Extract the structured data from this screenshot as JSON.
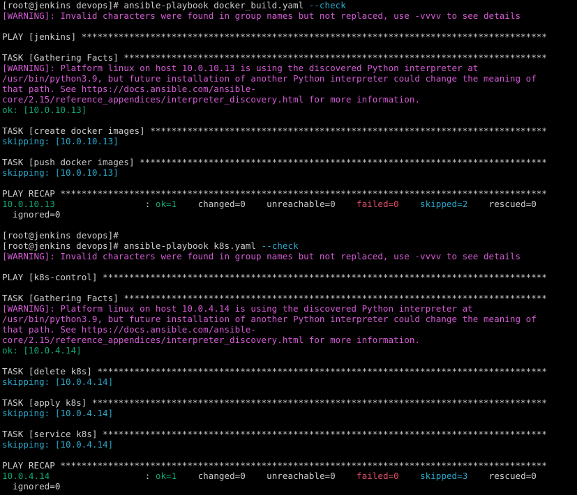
{
  "colors": {
    "background": "#000000",
    "default": "#cccccc",
    "warning": "#d35bd3",
    "ok": "#10a778",
    "skip": "#2aa7c9",
    "fail": "#e0506a"
  },
  "terminal_lines": [
    [
      {
        "t": "[root@jenkins devops]# ansible-playbook docker_build.yaml ",
        "c": "default"
      },
      {
        "t": "--check",
        "c": "skip"
      }
    ],
    [
      {
        "t": "[WARNING]: Invalid characters were found in group names but not replaced, use -vvvv to see details",
        "c": "warning"
      }
    ],
    [],
    [
      {
        "t": "PLAY [jenkins] ****************************************************************************************",
        "c": "default"
      }
    ],
    [],
    [
      {
        "t": "TASK [Gathering Facts] ********************************************************************************",
        "c": "default"
      }
    ],
    [
      {
        "t": "[WARNING]: Platform linux on host 10.0.10.13 is using the discovered Python interpreter at",
        "c": "warning"
      }
    ],
    [
      {
        "t": "/usr/bin/python3.9, but future installation of another Python interpreter could change the meaning of",
        "c": "warning"
      }
    ],
    [
      {
        "t": "that path. See https://docs.ansible.com/ansible-",
        "c": "warning"
      }
    ],
    [
      {
        "t": "core/2.15/reference_appendices/interpreter_discovery.html for more information.",
        "c": "warning"
      }
    ],
    [
      {
        "t": "ok: [10.0.10.13]",
        "c": "ok"
      }
    ],
    [],
    [
      {
        "t": "TASK [create docker images] ***************************************************************************",
        "c": "default"
      }
    ],
    [
      {
        "t": "skipping: [10.0.10.13]",
        "c": "skip"
      }
    ],
    [],
    [
      {
        "t": "TASK [push docker images] *****************************************************************************",
        "c": "default"
      }
    ],
    [
      {
        "t": "skipping: [10.0.10.13]",
        "c": "skip"
      }
    ],
    [],
    [
      {
        "t": "PLAY RECAP ********************************************************************************************",
        "c": "default"
      }
    ],
    [
      {
        "t": "10.0.10.13",
        "c": "ok"
      },
      {
        "t": "                 : ",
        "c": "default"
      },
      {
        "t": "ok=1",
        "c": "ok"
      },
      {
        "t": "    changed=0    unreachable=0    ",
        "c": "default"
      },
      {
        "t": "failed=0",
        "c": "fail"
      },
      {
        "t": "    ",
        "c": "default"
      },
      {
        "t": "skipped=2",
        "c": "skip"
      },
      {
        "t": "    rescued=0",
        "c": "default"
      }
    ],
    [
      {
        "t": "  ignored=0",
        "c": "default"
      }
    ],
    [],
    [
      {
        "t": "[root@jenkins devops]#",
        "c": "default"
      }
    ],
    [
      {
        "t": "[root@jenkins devops]# ansible-playbook k8s.yaml ",
        "c": "default"
      },
      {
        "t": "--check",
        "c": "skip"
      }
    ],
    [
      {
        "t": "[WARNING]: Invalid characters were found in group names but not replaced, use -vvvv to see details",
        "c": "warning"
      }
    ],
    [],
    [
      {
        "t": "PLAY [k8s-control] ************************************************************************************",
        "c": "default"
      }
    ],
    [],
    [
      {
        "t": "TASK [Gathering Facts] ********************************************************************************",
        "c": "default"
      }
    ],
    [
      {
        "t": "[WARNING]: Platform linux on host 10.0.4.14 is using the discovered Python interpreter at",
        "c": "warning"
      }
    ],
    [
      {
        "t": "/usr/bin/python3.9, but future installation of another Python interpreter could change the meaning of",
        "c": "warning"
      }
    ],
    [
      {
        "t": "that path. See https://docs.ansible.com/ansible-",
        "c": "warning"
      }
    ],
    [
      {
        "t": "core/2.15/reference_appendices/interpreter_discovery.html for more information.",
        "c": "warning"
      }
    ],
    [
      {
        "t": "ok: [10.0.4.14]",
        "c": "ok"
      }
    ],
    [],
    [
      {
        "t": "TASK [delete k8s] *************************************************************************************",
        "c": "default"
      }
    ],
    [
      {
        "t": "skipping: [10.0.4.14]",
        "c": "skip"
      }
    ],
    [],
    [
      {
        "t": "TASK [apply k8s] **************************************************************************************",
        "c": "default"
      }
    ],
    [
      {
        "t": "skipping: [10.0.4.14]",
        "c": "skip"
      }
    ],
    [],
    [
      {
        "t": "TASK [service k8s] ************************************************************************************",
        "c": "default"
      }
    ],
    [
      {
        "t": "skipping: [10.0.4.14]",
        "c": "skip"
      }
    ],
    [],
    [
      {
        "t": "PLAY RECAP ********************************************************************************************",
        "c": "default"
      }
    ],
    [
      {
        "t": "10.0.4.14",
        "c": "ok"
      },
      {
        "t": "                  : ",
        "c": "default"
      },
      {
        "t": "ok=1",
        "c": "ok"
      },
      {
        "t": "    changed=0    unreachable=0    ",
        "c": "default"
      },
      {
        "t": "failed=0",
        "c": "fail"
      },
      {
        "t": "    ",
        "c": "default"
      },
      {
        "t": "skipped=3",
        "c": "skip"
      },
      {
        "t": "    rescued=0",
        "c": "default"
      }
    ],
    [
      {
        "t": "  ignored=0",
        "c": "default"
      }
    ]
  ]
}
